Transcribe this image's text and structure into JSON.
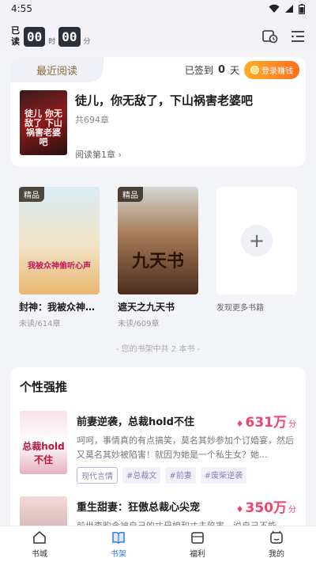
{
  "status": {
    "time": "4:55"
  },
  "reading_time": {
    "label": "已读",
    "hours": "00",
    "hours_unit": "时",
    "minutes": "00",
    "minutes_unit": "分"
  },
  "recent": {
    "tab_label": "最近阅读",
    "signin_prefix": "已签到",
    "signin_days": "0",
    "signin_unit": "天",
    "earn_button": "登录赚钱",
    "book": {
      "title": "徒儿，你无敌了，下山祸害老婆吧",
      "chapters": "共694章",
      "progress": "阅读第1章",
      "cover_text": "徒儿 你无敌了 下山祸害老婆吧"
    }
  },
  "shelf": {
    "books": [
      {
        "badge": "精品",
        "name": "封神：我被众神偷听心声",
        "status": "未读/614章",
        "cover_text": "我被众神偷听心声"
      },
      {
        "badge": "精品",
        "name": "遮天之九天书",
        "status": "未读/609章",
        "cover_text": "九天书"
      }
    ],
    "add_label": "发现更多书籍",
    "count_text": "- 您的书架中共 2 本书 -"
  },
  "recommend": {
    "title": "个性强推",
    "items": [
      {
        "name": "前妻逆袭，总裁hold不住",
        "heat": "631万",
        "heat_unit": "分",
        "desc": "呵呵，事情真的有点搞笑，莫名其妙参加个订婚宴，然后又莫名其妙被陷害！就因为她是一个私生女？她...",
        "tags": [
          "现代言情",
          "#总裁文",
          "#前妻",
          "#废柴逆袭"
        ],
        "cover_text": "总裁hold不住"
      },
      {
        "name": "重生甜妻：狂傲总裁心尖宠",
        "heat": "350万",
        "heat_unit": "分",
        "desc": "前世李昀含被自己的丈母娘和丈夫陷害，说自己不能"
      }
    ]
  },
  "nav": {
    "items": [
      {
        "label": "书城"
      },
      {
        "label": "书架"
      },
      {
        "label": "福利"
      },
      {
        "label": "我的"
      }
    ]
  },
  "colors": {
    "accent": "#2a7de1",
    "heat": "#f0446e",
    "earn": "#ff8a1e"
  }
}
